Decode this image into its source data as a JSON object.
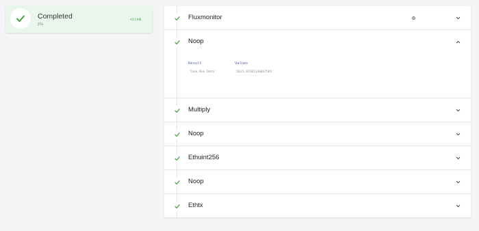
{
  "status": {
    "title": "Completed",
    "subtitle": "27s",
    "link": "+1 Link"
  },
  "tasks": [
    {
      "label": "Fluxmonitor",
      "expanded": false
    },
    {
      "label": "Noop",
      "expanded": true
    },
    {
      "label": "Multiply",
      "expanded": false
    },
    {
      "label": "Noop",
      "expanded": false
    },
    {
      "label": "Ethuint256",
      "expanded": false
    },
    {
      "label": "Noop",
      "expanded": false
    },
    {
      "label": "Ethtx",
      "expanded": false
    }
  ],
  "detail": {
    "headers": {
      "result": "Result",
      "values": "Values"
    },
    "row": {
      "result": "'Task Run Data'",
      "value": "'2621.92381336847565'"
    }
  },
  "colors": {
    "success": "#43a047",
    "accent": "#5b6aa8"
  }
}
